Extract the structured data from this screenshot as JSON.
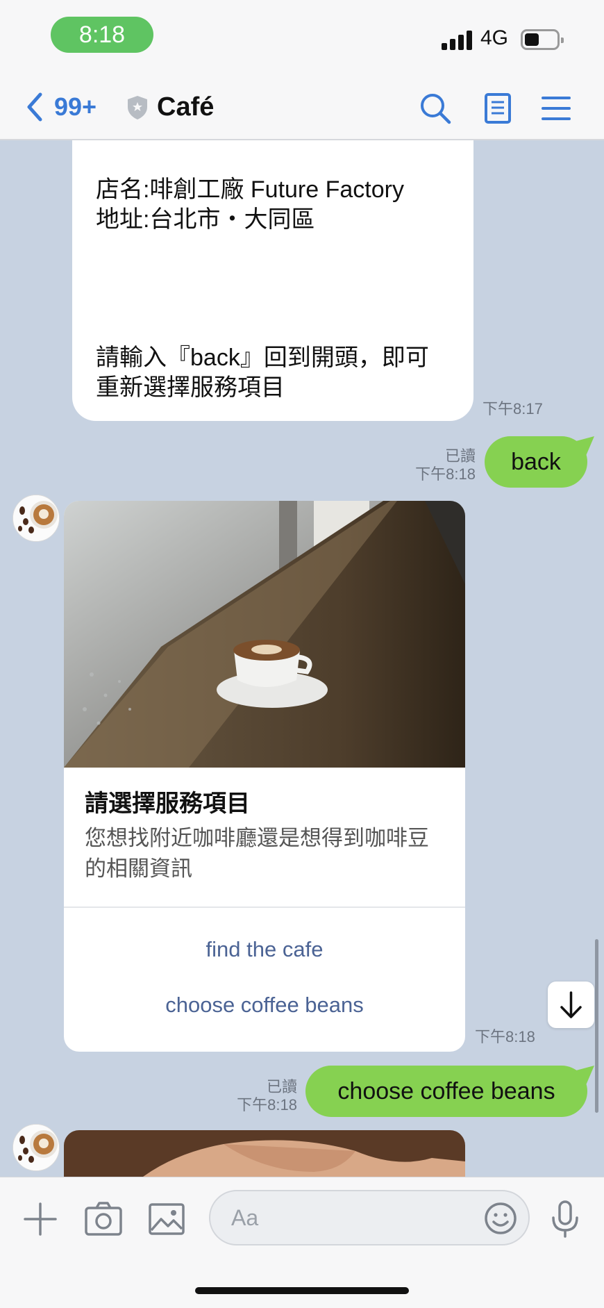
{
  "status_bar": {
    "time": "8:18",
    "network": "4G"
  },
  "header": {
    "back_count": "99+",
    "title": "Café"
  },
  "messages": {
    "bot_text": {
      "line1": "店名:啡創工廠 Future Factory",
      "line2": "地址:台北市・大同區",
      "line3": "請輸入『back』回到開頭，即可",
      "line4": "重新選擇服務項目",
      "time": "下午8:17"
    },
    "user_back": {
      "text": "back",
      "read": "已讀",
      "time": "下午8:18"
    },
    "bot_card": {
      "title": "請選擇服務項目",
      "description": "您想找附近咖啡廳還是想得到咖啡豆的相關資訊",
      "actions": [
        "find the cafe",
        "choose coffee beans"
      ],
      "time": "下午8:18"
    },
    "user_choice": {
      "text": "choose coffee beans",
      "read": "已讀",
      "time": "下午8:18"
    }
  },
  "input_bar": {
    "placeholder": "Aa"
  },
  "colors": {
    "chat_bg": "#c7d2e1",
    "user_bubble": "#86d151",
    "accent": "#3a7ad6",
    "action_text": "#4b6394",
    "status_pill": "#5fc462"
  }
}
